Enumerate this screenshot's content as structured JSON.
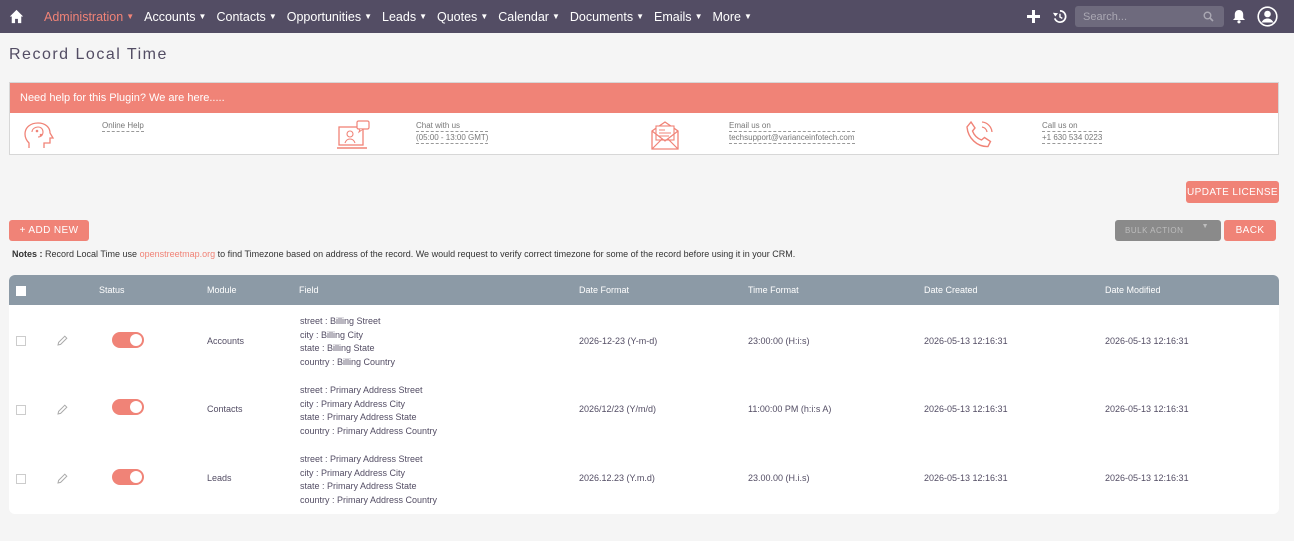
{
  "nav": {
    "menu": [
      {
        "label": "Administration",
        "active": true
      },
      {
        "label": "Accounts"
      },
      {
        "label": "Contacts"
      },
      {
        "label": "Opportunities"
      },
      {
        "label": "Leads"
      },
      {
        "label": "Quotes"
      },
      {
        "label": "Calendar"
      },
      {
        "label": "Documents"
      },
      {
        "label": "Emails"
      },
      {
        "label": "More"
      }
    ],
    "search_placeholder": "Search..."
  },
  "page_title": "Record Local Time",
  "help": {
    "header": "Need help for this Plugin? We are here.....",
    "items": [
      {
        "line1": "Online Help",
        "icon": "brain-icon"
      },
      {
        "line1": "Chat with us",
        "line2": "(05:00 - 13:00 GMT)",
        "icon": "chat-icon"
      },
      {
        "line1": "Email us on",
        "line2": "techsupport@varianceinfotech.com",
        "icon": "email-icon"
      },
      {
        "line1": "Call us on",
        "line2": "+1 630 534 0223",
        "icon": "phone-icon"
      }
    ]
  },
  "buttons": {
    "update_license": "UPDATE LICENSE",
    "add_new": "+ ADD NEW",
    "bulk_action": "BULK ACTION",
    "back": "BACK"
  },
  "notes": {
    "label": "Notes :",
    "before": " Record Local Time use ",
    "link": "openstreetmap.org",
    "after": " to find Timezone based on address of the record. We would request to verify correct timezone for some of the record before using it in your CRM."
  },
  "table": {
    "headers": [
      "Status",
      "Module",
      "Field",
      "Date Format",
      "Time Format",
      "Date Created",
      "Date Modified"
    ],
    "rows": [
      {
        "module": "Accounts",
        "field": [
          "street : Billing Street",
          "city : Billing City",
          "state : Billing State",
          "country : Billing Country"
        ],
        "date_format": "2026-12-23 (Y-m-d)",
        "time_format": "23:00:00 (H:i:s)",
        "created": "2026-05-13 12:16:31",
        "modified": "2026-05-13 12:16:31"
      },
      {
        "module": "Contacts",
        "field": [
          "street : Primary Address Street",
          "city : Primary Address City",
          "state : Primary Address State",
          "country : Primary Address Country"
        ],
        "date_format": "2026/12/23 (Y/m/d)",
        "time_format": "11:00:00 PM (h:i:s A)",
        "created": "2026-05-13 12:16:31",
        "modified": "2026-05-13 12:16:31"
      },
      {
        "module": "Leads",
        "field": [
          "street : Primary Address Street",
          "city : Primary Address City",
          "state : Primary Address State",
          "country : Primary Address Country"
        ],
        "date_format": "2026.12.23 (Y.m.d)",
        "time_format": "23.00.00 (H.i.s)",
        "created": "2026-05-13 12:16:31",
        "modified": "2026-05-13 12:16:31"
      }
    ]
  },
  "colors": {
    "accent": "#f08377",
    "nav_bg": "#534d64",
    "table_head": "#8c9aa6"
  }
}
